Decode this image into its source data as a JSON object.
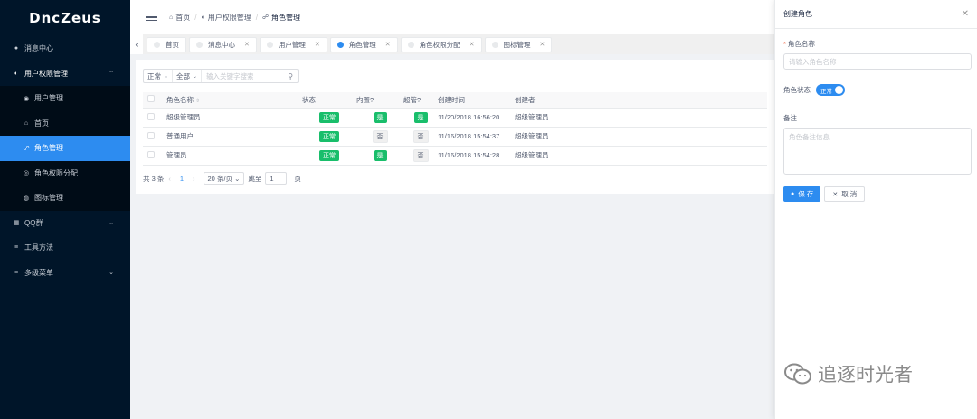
{
  "app": {
    "logo": "DncZeus"
  },
  "sidebar": {
    "items": [
      {
        "label": "消息中心",
        "icon": "bell-icon",
        "glyph": "●"
      },
      {
        "label": "用户权限管理",
        "icon": "user-shield-icon",
        "glyph": "◐",
        "chevron": "⌃"
      },
      {
        "label": "QQ群",
        "icon": "grid-icon",
        "glyph": "▦",
        "chevron": "⌄"
      },
      {
        "label": "工具方法",
        "icon": "list-icon",
        "glyph": "≡"
      },
      {
        "label": "多级菜单",
        "icon": "list-icon",
        "glyph": "≡",
        "chevron": "⌄"
      }
    ],
    "submenu": [
      {
        "label": "用户管理",
        "icon": "user-icon",
        "glyph": "◉"
      },
      {
        "label": "首页",
        "icon": "home-icon",
        "glyph": "⌂"
      },
      {
        "label": "角色管理",
        "icon": "people-icon",
        "glyph": "☍"
      },
      {
        "label": "角色权限分配",
        "icon": "key-icon",
        "glyph": "◎"
      },
      {
        "label": "图标管理",
        "icon": "image-icon",
        "glyph": "◍"
      }
    ]
  },
  "breadcrumb": {
    "home": "首页",
    "parent": "用户权限管理",
    "current": "角色管理"
  },
  "tabs": [
    {
      "label": "首页",
      "closable": false
    },
    {
      "label": "消息中心",
      "closable": true
    },
    {
      "label": "用户管理",
      "closable": true
    },
    {
      "label": "角色管理",
      "closable": true
    },
    {
      "label": "角色权限分配",
      "closable": true
    },
    {
      "label": "图标管理",
      "closable": true
    }
  ],
  "filter": {
    "status": "正常",
    "scope": "全部",
    "search_placeholder": "输入关键字搜索"
  },
  "table": {
    "headers": {
      "name": "角色名称",
      "status": "状态",
      "builtin": "内置?",
      "super": "超管?",
      "created": "创建时间",
      "creator": "创建者"
    },
    "rows": [
      {
        "name": "超级管理员",
        "status": "正常",
        "builtin": "是",
        "super": "是",
        "created": "11/20/2018 16:56:20",
        "creator": "超级管理员"
      },
      {
        "name": "普通用户",
        "status": "正常",
        "builtin": "否",
        "super": "否",
        "created": "11/16/2018 15:54:37",
        "creator": "超级管理员"
      },
      {
        "name": "管理员",
        "status": "正常",
        "builtin": "是",
        "super": "否",
        "created": "11/16/2018 15:54:28",
        "creator": "超级管理员"
      }
    ]
  },
  "pager": {
    "total": "共 3 条",
    "page": "1",
    "size": "20 条/页",
    "goto": "跳至",
    "goto_value": "1",
    "page_unit": "页"
  },
  "drawer": {
    "title": "创建角色",
    "name_label": "角色名称",
    "name_placeholder": "请输入角色名称",
    "status_label": "角色状态",
    "status_value": "正常",
    "remark_label": "备注",
    "remark_placeholder": "角色备注信息",
    "save": "保 存",
    "cancel": "取 消"
  },
  "watermark": "追逐时光者"
}
